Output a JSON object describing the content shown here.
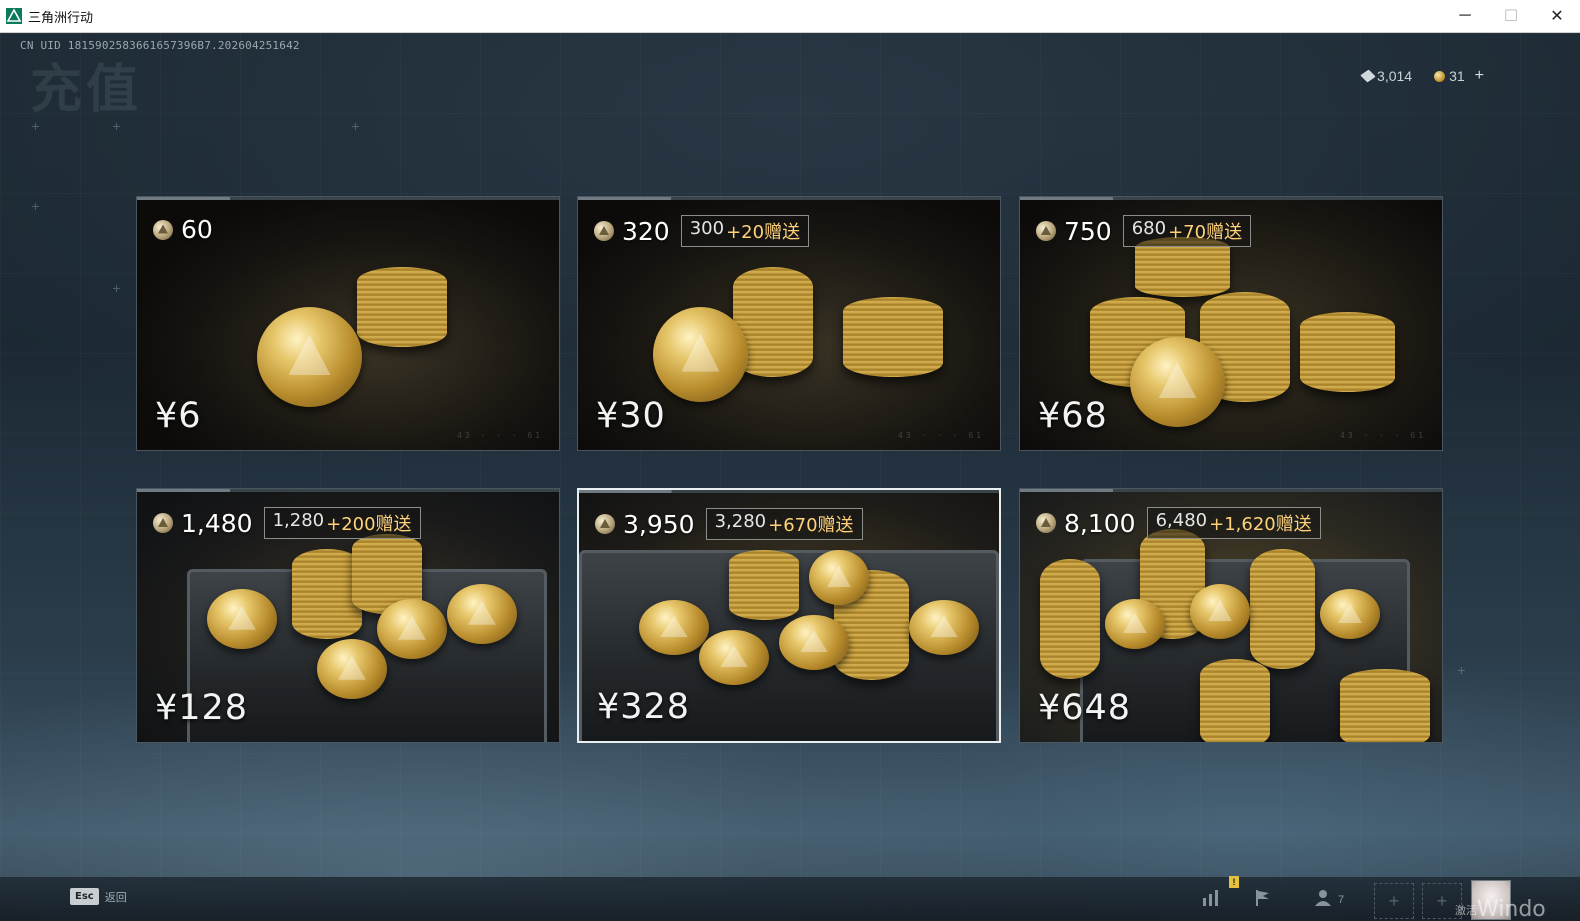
{
  "window": {
    "title": "三角洲行动",
    "minimize_glyph": "─",
    "maximize_glyph": "☐",
    "close_glyph": "✕"
  },
  "header": {
    "uid": "CN UID 1815902583661657396B7.202604251642",
    "page_title": "充值"
  },
  "currency": {
    "bonds": "3,014",
    "coins": "31",
    "add_glyph": "+"
  },
  "packages": [
    {
      "amount": "60",
      "base": "",
      "extra": "",
      "price": "¥6",
      "serial": "43 · · · 61"
    },
    {
      "amount": "320",
      "base": "300",
      "extra": "+20赠送",
      "price": "¥30",
      "serial": "43 · · · 61"
    },
    {
      "amount": "750",
      "base": "680",
      "extra": "+70赠送",
      "price": "¥68",
      "serial": "43 · · · 61"
    },
    {
      "amount": "1,480",
      "base": "1,280",
      "extra": "+200赠送",
      "price": "¥128",
      "serial": ""
    },
    {
      "amount": "3,950",
      "base": "3,280",
      "extra": "+670赠送",
      "price": "¥328",
      "serial": ""
    },
    {
      "amount": "8,100",
      "base": "6,480",
      "extra": "+1,620赠送",
      "price": "¥648",
      "serial": ""
    }
  ],
  "selected_package_index": 4,
  "footer": {
    "esc_key": "Esc",
    "esc_label": "返回",
    "alert_badge": "!",
    "friends_count": "7",
    "slot_glyph": "+",
    "activation_text_small": "激活",
    "activation_text": "Windo"
  },
  "colors": {
    "bonus_extra": "#ffd27a",
    "selected_border": "#e9eef0",
    "card_border": "#4b5760"
  }
}
